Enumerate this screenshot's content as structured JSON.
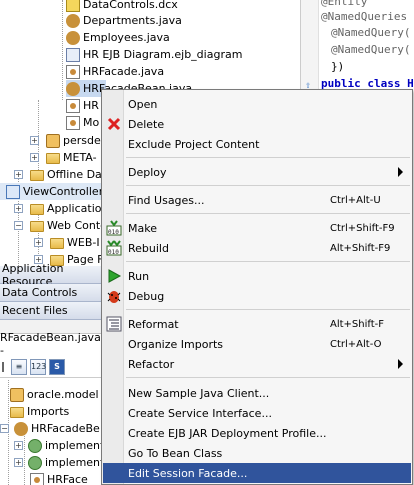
{
  "tree": {
    "items": [
      {
        "label": "DataControls.dcx"
      },
      {
        "label": "Departments.java"
      },
      {
        "label": "Employees.java"
      },
      {
        "label": "HR EJB Diagram.ejb_diagram"
      },
      {
        "label": "HRFacade.java"
      },
      {
        "label": "HRFacadeBean.java"
      },
      {
        "label": "HR"
      },
      {
        "label": "Mo"
      },
      {
        "label": "persde"
      },
      {
        "label": "META-"
      },
      {
        "label": "Offline Dat"
      },
      {
        "label": "ViewController"
      },
      {
        "label": "Applicatio"
      },
      {
        "label": "Web Conte"
      },
      {
        "label": "WEB-I"
      },
      {
        "label": "Page F"
      }
    ]
  },
  "sections": {
    "app_resources": "Application Resource",
    "data_controls": "Data Controls",
    "recent_files": "Recent Files"
  },
  "structure": {
    "title": "RFacadeBean.java -",
    "toolbar": {
      "btn1": "≡",
      "btn2": "123",
      "btn3": "S"
    },
    "items": [
      {
        "label": "oracle.model"
      },
      {
        "label": "Imports"
      },
      {
        "label": "HRFacadeBe"
      },
      {
        "label": "implements"
      },
      {
        "label": "implements"
      },
      {
        "label": "HRFace"
      }
    ]
  },
  "editor": {
    "lines": [
      "@Entity",
      "@NamedQueries",
      "@NamedQuery(",
      "@NamedQuery(",
      "})",
      "public class H"
    ]
  },
  "menu": {
    "items": [
      {
        "label": "Open",
        "icon": "none"
      },
      {
        "label": "Delete",
        "icon": "delete-x-icon"
      },
      {
        "label": "Exclude Project Content",
        "icon": "none"
      },
      {
        "label": "Deploy",
        "icon": "none",
        "submenu": true
      },
      {
        "label": "Find Usages...",
        "accel": "Ctrl+Alt-U"
      },
      {
        "label": "Make",
        "accel": "Ctrl+Shift-F9",
        "icon": "make-icon"
      },
      {
        "label": "Rebuild",
        "accel": "Alt+Shift-F9",
        "icon": "rebuild-icon"
      },
      {
        "label": "Run",
        "icon": "run-icon"
      },
      {
        "label": "Debug",
        "icon": "debug-icon"
      },
      {
        "label": "Reformat",
        "accel": "Alt+Shift-F",
        "icon": "reformat-icon"
      },
      {
        "label": "Organize Imports",
        "accel": "Ctrl+Alt-O"
      },
      {
        "label": "Refactor",
        "submenu": true
      },
      {
        "label": "New Sample Java Client..."
      },
      {
        "label": "Create Service Interface..."
      },
      {
        "label": "Create EJB JAR Deployment Profile..."
      },
      {
        "label": "Go To Bean Class"
      },
      {
        "label": "Edit Session Facade..."
      }
    ]
  },
  "colors": {
    "menu_highlight": "#30549c",
    "tree_selection": "#c7d9f0"
  }
}
